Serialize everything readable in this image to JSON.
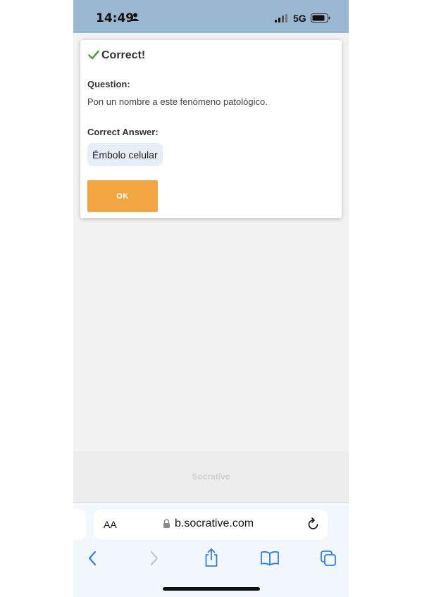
{
  "status_bar": {
    "time": "14:49",
    "network": "5G",
    "icons": [
      "person-icon",
      "signal-icon",
      "battery-icon"
    ]
  },
  "modal": {
    "title": "Correct!",
    "question_label": "Question:",
    "question_text": "Pon un nombre a este fenómeno patológico.",
    "answer_label": "Correct Answer:",
    "answer_value": "Émbolo celular",
    "ok_label": "OK",
    "accent_color": "#f2a541",
    "check_color": "#5a9e3a"
  },
  "footer": {
    "brand": "Socrative"
  },
  "browser": {
    "text_size_label": "AA",
    "url": "b.socrative.com",
    "toolbar_icons": [
      "back-icon",
      "forward-icon",
      "share-icon",
      "bookmarks-icon",
      "tabs-icon"
    ]
  }
}
